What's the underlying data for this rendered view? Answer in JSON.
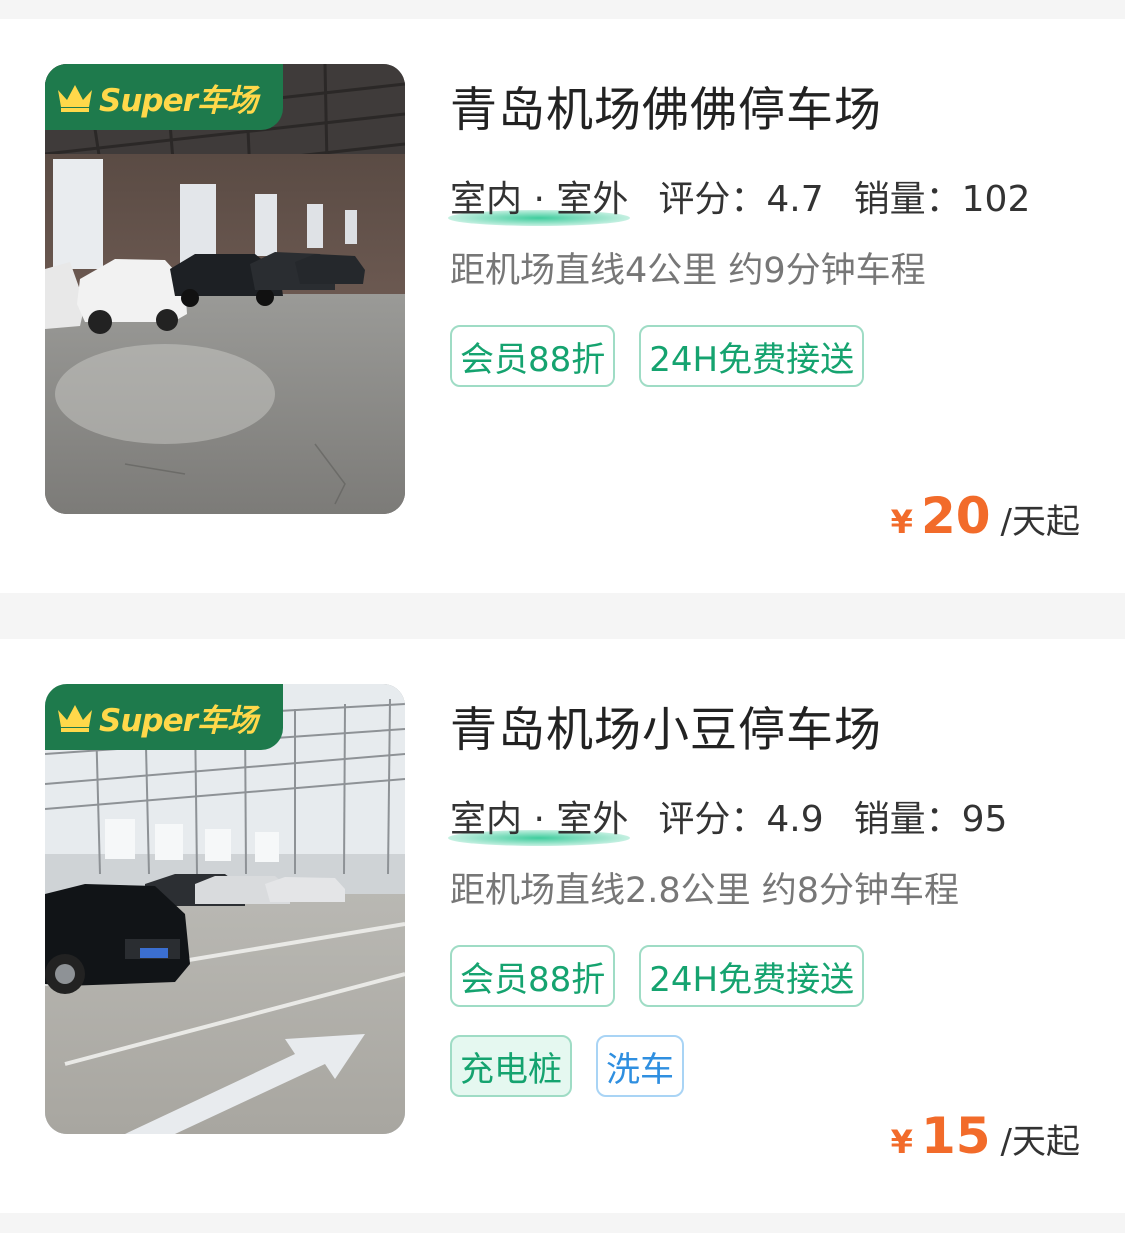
{
  "lots": [
    {
      "name": "青岛机场佛佛停车场",
      "badge": "Super车场",
      "type": "室内 · 室外",
      "rating_label": "评分：",
      "rating": "4.7",
      "sales_label": "销量：",
      "sales": "102",
      "distance": "距机场直线4公里 约9分钟车程",
      "tags": [
        "会员88折",
        "24H免费接送"
      ],
      "price_currency": "¥",
      "price": "20",
      "price_unit": "/天起"
    },
    {
      "name": "青岛机场小豆停车场",
      "badge": "Super车场",
      "type": "室内 · 室外",
      "rating_label": "评分：",
      "rating": "4.9",
      "sales_label": "销量：",
      "sales": "95",
      "distance": "距机场直线2.8公里 约8分钟车程",
      "tags": [
        "会员88折",
        "24H免费接送"
      ],
      "extra_tags": [
        "充电桩",
        "洗车"
      ],
      "price_currency": "¥",
      "price": "15",
      "price_unit": "/天起"
    }
  ],
  "colors": {
    "accent_green": "#15a36f",
    "badge_green": "#1e7a4c",
    "badge_gold": "#ffd84a",
    "price_orange": "#f26b2a",
    "tag_blue": "#2f8fe0"
  }
}
